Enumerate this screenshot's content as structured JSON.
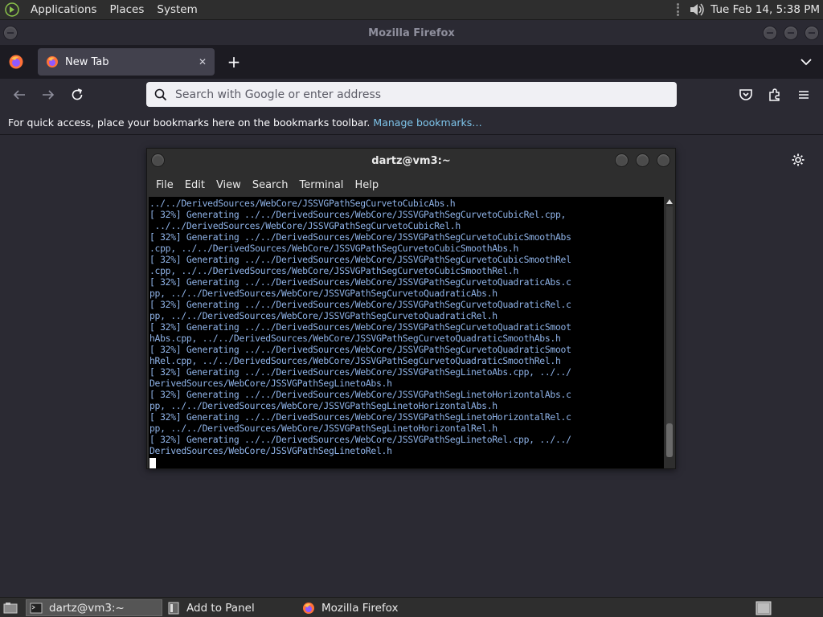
{
  "top_panel": {
    "menus": [
      "Applications",
      "Places",
      "System"
    ],
    "clock": "Tue Feb 14,  5:38 PM"
  },
  "firefox": {
    "window_title": "Mozilla Firefox",
    "tab_label": "New Tab",
    "url_placeholder": "Search with Google or enter address",
    "bookmarks_text": "For quick access, place your bookmarks here on the bookmarks toolbar.",
    "bookmarks_link": "Manage bookmarks…"
  },
  "terminal": {
    "title": "dartz@vm3:~",
    "menu": [
      "File",
      "Edit",
      "View",
      "Search",
      "Terminal",
      "Help"
    ],
    "lines": [
      "../../DerivedSources/WebCore/JSSVGPathSegCurvetoCubicAbs.h",
      "[ 32%] Generating ../../DerivedSources/WebCore/JSSVGPathSegCurvetoCubicRel.cpp,",
      " ../../DerivedSources/WebCore/JSSVGPathSegCurvetoCubicRel.h",
      "[ 32%] Generating ../../DerivedSources/WebCore/JSSVGPathSegCurvetoCubicSmoothAbs",
      ".cpp, ../../DerivedSources/WebCore/JSSVGPathSegCurvetoCubicSmoothAbs.h",
      "[ 32%] Generating ../../DerivedSources/WebCore/JSSVGPathSegCurvetoCubicSmoothRel",
      ".cpp, ../../DerivedSources/WebCore/JSSVGPathSegCurvetoCubicSmoothRel.h",
      "[ 32%] Generating ../../DerivedSources/WebCore/JSSVGPathSegCurvetoQuadraticAbs.c",
      "pp, ../../DerivedSources/WebCore/JSSVGPathSegCurvetoQuadraticAbs.h",
      "[ 32%] Generating ../../DerivedSources/WebCore/JSSVGPathSegCurvetoQuadraticRel.c",
      "pp, ../../DerivedSources/WebCore/JSSVGPathSegCurvetoQuadraticRel.h",
      "[ 32%] Generating ../../DerivedSources/WebCore/JSSVGPathSegCurvetoQuadraticSmoot",
      "hAbs.cpp, ../../DerivedSources/WebCore/JSSVGPathSegCurvetoQuadraticSmoothAbs.h",
      "[ 32%] Generating ../../DerivedSources/WebCore/JSSVGPathSegCurvetoQuadraticSmoot",
      "hRel.cpp, ../../DerivedSources/WebCore/JSSVGPathSegCurvetoQuadraticSmoothRel.h",
      "[ 32%] Generating ../../DerivedSources/WebCore/JSSVGPathSegLinetoAbs.cpp, ../../",
      "DerivedSources/WebCore/JSSVGPathSegLinetoAbs.h",
      "[ 32%] Generating ../../DerivedSources/WebCore/JSSVGPathSegLinetoHorizontalAbs.c",
      "pp, ../../DerivedSources/WebCore/JSSVGPathSegLinetoHorizontalAbs.h",
      "[ 32%] Generating ../../DerivedSources/WebCore/JSSVGPathSegLinetoHorizontalRel.c",
      "pp, ../../DerivedSources/WebCore/JSSVGPathSegLinetoHorizontalRel.h",
      "[ 32%] Generating ../../DerivedSources/WebCore/JSSVGPathSegLinetoRel.cpp, ../../",
      "DerivedSources/WebCore/JSSVGPathSegLinetoRel.h"
    ]
  },
  "bottom_panel": {
    "items": [
      "dartz@vm3:~",
      "Add to Panel",
      "Mozilla Firefox"
    ]
  }
}
